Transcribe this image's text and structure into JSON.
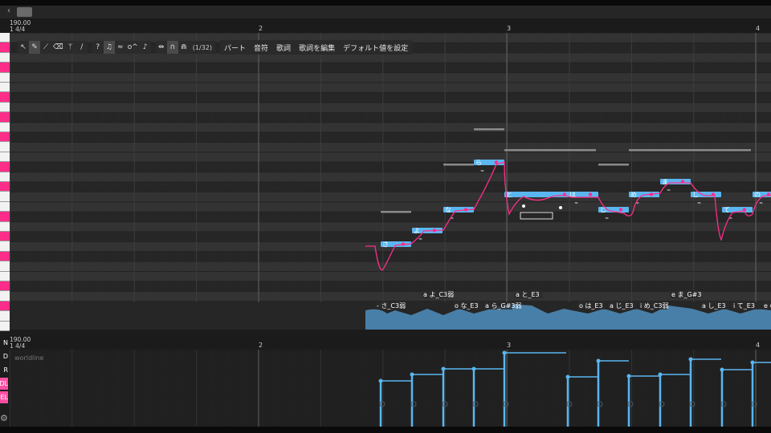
{
  "ruler": {
    "tempo": "190.00",
    "signature": "1 4/4",
    "bars": [
      "2",
      "3",
      "4"
    ]
  },
  "lower_ruler": {
    "tempo": "190.00",
    "signature": "1 4/4",
    "bars": [
      "2",
      "3",
      "4"
    ]
  },
  "toolbar": {
    "tools": [
      {
        "icon": "cursor-icon",
        "glyph": "↖"
      },
      {
        "icon": "pencil-icon",
        "glyph": "✎"
      },
      {
        "icon": "line-pencil-icon",
        "glyph": "⟋"
      },
      {
        "icon": "eraser-icon",
        "glyph": "⌫"
      },
      {
        "icon": "brush-icon",
        "glyph": "⌇"
      },
      {
        "icon": "knife-icon",
        "glyph": "/"
      }
    ],
    "toggles": [
      {
        "icon": "help-icon",
        "glyph": "?"
      },
      {
        "icon": "note-icon",
        "glyph": "♫"
      },
      {
        "icon": "vibrato-icon",
        "glyph": "≈"
      },
      {
        "icon": "pitch-icon",
        "glyph": "o^"
      },
      {
        "icon": "fade-icon",
        "glyph": "⤴"
      },
      {
        "icon": "snap-icon",
        "glyph": "⇹"
      },
      {
        "icon": "curve-icon",
        "glyph": "∩"
      },
      {
        "icon": "envelope-icon",
        "glyph": "⋒"
      }
    ],
    "snap": "(1/32)",
    "menus": [
      "パート",
      "音符",
      "歌詞",
      "歌詞を編集",
      "デフォルト値を設定"
    ]
  },
  "phonemes": [
    "- さ_C3弱",
    "a よ_C3弱",
    "o な_E3",
    "a ら_G#3弱",
    "a と_E3",
    "o は_E3",
    "a じ_E3",
    "i め_C3弱",
    "e ま_G#3",
    "a し_E3",
    "i て_E3",
    "e の_E"
  ],
  "note_lyrics": [
    "さ",
    "よ",
    "な",
    "ら",
    "と",
    "は",
    "じ",
    "め",
    "ま",
    "し",
    "て",
    "の"
  ],
  "expression_label": "worldline",
  "side_buttons": [
    "N",
    "D",
    "R",
    "DL",
    "EL"
  ],
  "colors": {
    "accent": "#ff2d8a",
    "note": "#5ab6f0",
    "background": "#2a2a2a"
  }
}
